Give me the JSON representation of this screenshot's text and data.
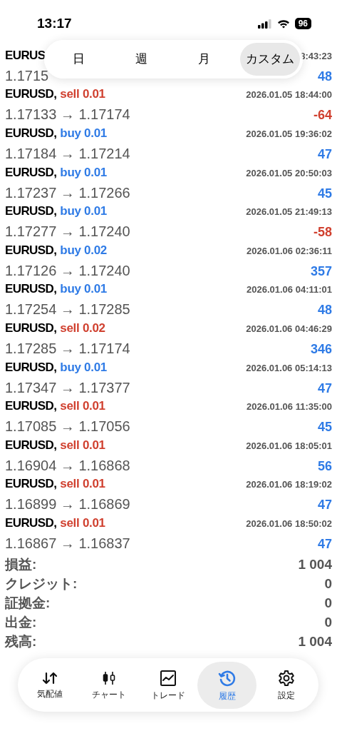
{
  "status_bar": {
    "time": "13:17",
    "battery": "96"
  },
  "period_tabs": [
    {
      "label": "日",
      "selected": false
    },
    {
      "label": "週",
      "selected": false
    },
    {
      "label": "月",
      "selected": false
    },
    {
      "label": "カスタム",
      "selected": true
    }
  ],
  "deals": [
    {
      "symbol": "EURUS",
      "prices": "1.1715",
      "time": "8:43:23",
      "profit": "48"
    },
    {
      "symbol": "EURUSD,",
      "side": "sell 0.01",
      "prices": "1.17133 → 1.17174",
      "time": "2026.01.05 18:44:00",
      "profit": "-64",
      "kind": "sell"
    },
    {
      "symbol": "EURUSD,",
      "side": "buy 0.01",
      "prices": "1.17184 → 1.17214",
      "time": "2026.01.05 19:36:02",
      "profit": "47",
      "kind": "buy"
    },
    {
      "symbol": "EURUSD,",
      "side": "buy 0.01",
      "prices": "1.17237 → 1.17266",
      "time": "2026.01.05 20:50:03",
      "profit": "45",
      "kind": "buy"
    },
    {
      "symbol": "EURUSD,",
      "side": "buy 0.01",
      "prices": "1.17277 → 1.17240",
      "time": "2026.01.05 21:49:13",
      "profit": "-58",
      "kind": "buy"
    },
    {
      "symbol": "EURUSD,",
      "side": "buy 0.02",
      "prices": "1.17126 → 1.17240",
      "time": "2026.01.06 02:36:11",
      "profit": "357",
      "kind": "buy"
    },
    {
      "symbol": "EURUSD,",
      "side": "buy 0.01",
      "prices": "1.17254 → 1.17285",
      "time": "2026.01.06 04:11:01",
      "profit": "48",
      "kind": "buy"
    },
    {
      "symbol": "EURUSD,",
      "side": "sell 0.02",
      "prices": "1.17285 → 1.17174",
      "time": "2026.01.06 04:46:29",
      "profit": "346",
      "kind": "sell"
    },
    {
      "symbol": "EURUSD,",
      "side": "buy 0.01",
      "prices": "1.17347 → 1.17377",
      "time": "2026.01.06 05:14:13",
      "profit": "47",
      "kind": "buy"
    },
    {
      "symbol": "EURUSD,",
      "side": "sell 0.01",
      "prices": "1.17085 → 1.17056",
      "time": "2026.01.06 11:35:00",
      "profit": "45",
      "kind": "sell"
    },
    {
      "symbol": "EURUSD,",
      "side": "sell 0.01",
      "prices": "1.16904 → 1.16868",
      "time": "2026.01.06 18:05:01",
      "profit": "56",
      "kind": "sell"
    },
    {
      "symbol": "EURUSD,",
      "side": "sell 0.01",
      "prices": "1.16899 → 1.16869",
      "time": "2026.01.06 18:19:02",
      "profit": "47",
      "kind": "sell"
    },
    {
      "symbol": "EURUSD,",
      "side": "sell 0.01",
      "prices": "1.16867 → 1.16837",
      "time": "2026.01.06 18:50:02",
      "profit": "47",
      "kind": "sell"
    }
  ],
  "summary": [
    {
      "label": "損益:",
      "value": "1 004"
    },
    {
      "label": "クレジット:",
      "value": "0"
    },
    {
      "label": "証拠金:",
      "value": "0"
    },
    {
      "label": "出金:",
      "value": "0"
    },
    {
      "label": "残高:",
      "value": "1 004"
    }
  ],
  "nav": [
    {
      "label": "気配値",
      "selected": false
    },
    {
      "label": "チャート",
      "selected": false
    },
    {
      "label": "トレード",
      "selected": false
    },
    {
      "label": "履歴",
      "selected": true
    },
    {
      "label": "設定",
      "selected": false
    }
  ]
}
